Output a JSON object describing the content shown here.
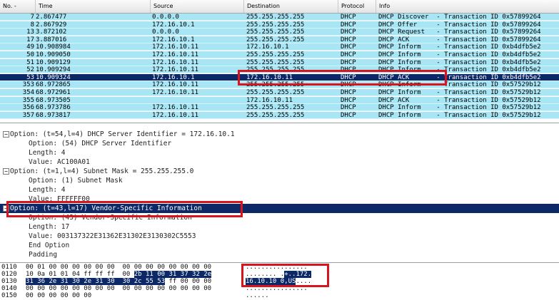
{
  "packet_list": {
    "columns": [
      "No. -",
      "Time",
      "Source",
      "Destination",
      "Protocol",
      "Info"
    ],
    "rows": [
      {
        "no": "7",
        "time": "2.867477",
        "src": "0.0.0.0",
        "dst": "255.255.255.255",
        "proto": "DHCP",
        "info": "DHCP Discover  - Transaction ID 0x57899264",
        "bg": "#a8e6f6",
        "fg": "#000000"
      },
      {
        "no": "8",
        "time": "2.867929",
        "src": "172.16.10.1",
        "dst": "255.255.255.255",
        "proto": "DHCP",
        "info": "DHCP Offer     - Transaction ID 0x57899264",
        "bg": "#a8e6f6",
        "fg": "#000000"
      },
      {
        "no": "13",
        "time": "3.872102",
        "src": "0.0.0.0",
        "dst": "255.255.255.255",
        "proto": "DHCP",
        "info": "DHCP Request   - Transaction ID 0x57899264",
        "bg": "#a8e6f6",
        "fg": "#000000"
      },
      {
        "no": "17",
        "time": "3.887016",
        "src": "172.16.10.1",
        "dst": "255.255.255.255",
        "proto": "DHCP",
        "info": "DHCP ACK       - Transaction ID 0x57899264",
        "bg": "#a8e6f6",
        "fg": "#000000"
      },
      {
        "no": "49",
        "time": "10.908984",
        "src": "172.16.10.11",
        "dst": "172.16.10.1",
        "proto": "DHCP",
        "info": "DHCP Inform    - Transaction ID 0xb4dfb5e2",
        "bg": "#a8e6f6",
        "fg": "#000000"
      },
      {
        "no": "50",
        "time": "10.909050",
        "src": "172.16.10.11",
        "dst": "255.255.255.255",
        "proto": "DHCP",
        "info": "DHCP Inform    - Transaction ID 0xb4dfb5e2",
        "bg": "#a8e6f6",
        "fg": "#000000"
      },
      {
        "no": "51",
        "time": "10.909129",
        "src": "172.16.10.11",
        "dst": "255.255.255.255",
        "proto": "DHCP",
        "info": "DHCP Inform    - Transaction ID 0xb4dfb5e2",
        "bg": "#a8e6f6",
        "fg": "#000000"
      },
      {
        "no": "52",
        "time": "10.909294",
        "src": "172.16.10.11",
        "dst": "255.255.255.255",
        "proto": "DHCP",
        "info": "DHCP Inform    - Transaction ID 0xb4dfb5e2",
        "bg": "#a8e6f6",
        "fg": "#000000"
      },
      {
        "no": "53",
        "time": "10.909324",
        "src": "172.16.10.1",
        "dst": "172.16.10.11",
        "proto": "DHCP",
        "info": "DHCP ACK       - Transaction ID 0xb4dfb5e2",
        "bg": "#0c2866",
        "fg": "#ffffff"
      },
      {
        "no": "353",
        "time": "68.972865",
        "src": "172.16.10.11",
        "dst": "255.255.255.255",
        "proto": "DHCP",
        "info": "DHCP Inform    - Transaction ID 0x57529b12",
        "bg": "#a8e6f6",
        "fg": "#000000"
      },
      {
        "no": "354",
        "time": "68.972961",
        "src": "172.16.10.11",
        "dst": "255.255.255.255",
        "proto": "DHCP",
        "info": "DHCP Inform    - Transaction ID 0x57529b12",
        "bg": "#a8e6f6",
        "fg": "#000000"
      },
      {
        "no": "355",
        "time": "68.973505",
        "src": "",
        "dst": "172.16.10.11",
        "proto": "DHCP",
        "info": "DHCP ACK       - Transaction ID 0x57529b12",
        "bg": "#a8e6f6",
        "fg": "#000000"
      },
      {
        "no": "356",
        "time": "68.973786",
        "src": "172.16.10.11",
        "dst": "255.255.255.255",
        "proto": "DHCP",
        "info": "DHCP Inform    - Transaction ID 0x57529b12",
        "bg": "#a8e6f6",
        "fg": "#000000"
      },
      {
        "no": "357",
        "time": "68.973817",
        "src": "172.16.10.11",
        "dst": "255.255.255.255",
        "proto": "DHCP",
        "info": "DHCP Inform    - Transaction ID 0x57529b12",
        "bg": "#a8e6f6",
        "fg": "#000000"
      }
    ]
  },
  "details": [
    {
      "text": "Option: (t=54,l=4) DHCP Server Identifier = 172.16.10.1",
      "level": 0,
      "expander": "minus",
      "selected": false
    },
    {
      "text": "Option: (54) DHCP Server Identifier",
      "level": 1,
      "expander": "",
      "selected": false
    },
    {
      "text": "Length: 4",
      "level": 1,
      "expander": "",
      "selected": false
    },
    {
      "text": "Value: AC100A01",
      "level": 1,
      "expander": "",
      "selected": false
    },
    {
      "text": "Option: (t=1,l=4) Subnet Mask = 255.255.255.0",
      "level": 0,
      "expander": "minus",
      "selected": false
    },
    {
      "text": "Option: (1) Subnet Mask",
      "level": 1,
      "expander": "",
      "selected": false
    },
    {
      "text": "Length: 4",
      "level": 1,
      "expander": "",
      "selected": false
    },
    {
      "text": "Value: FFFFFF00",
      "level": 1,
      "expander": "",
      "selected": false
    },
    {
      "text": "Option: (t=43,l=17) Vendor-Specific Information",
      "level": 0,
      "expander": "minus",
      "selected": true
    },
    {
      "text": "Option: (43) Vendor-Specific Information",
      "level": 1,
      "expander": "",
      "selected": false
    },
    {
      "text": "Length: 17",
      "level": 1,
      "expander": "",
      "selected": false
    },
    {
      "text": "Value: 003137322E31362E31302E3130302C5553",
      "level": 1,
      "expander": "",
      "selected": false
    },
    {
      "text": "End Option",
      "level": 1,
      "expander": "",
      "selected": false
    },
    {
      "text": "Padding",
      "level": 1,
      "expander": "",
      "selected": false
    }
  ],
  "bytes": [
    {
      "offset": "0110",
      "hex_plain": "00 01 00 00 00 00 00 00  00 00 00 00 00 00 00 00",
      "hex_sel": "",
      "hex_tail": "",
      "ascii_plain": "................",
      "ascii_sel": "",
      "ascii_tail": ""
    },
    {
      "offset": "0120",
      "hex_plain": "10 0a 01 01 04 ff ff ff  00 ",
      "hex_sel": "2b 11 00 31 37 32 2e",
      "hex_tail": "",
      "ascii_plain": "........ .",
      "ascii_sel": "+..172.",
      "ascii_tail": ""
    },
    {
      "offset": "0130",
      "hex_plain": "",
      "hex_sel": "31 36 2e 31 30 2e 31 30  30 2c 55 53",
      "hex_tail": " ff 00 00 00",
      "ascii_plain": "",
      "ascii_sel": "16.10.10 0,US",
      "ascii_tail": "...."
    },
    {
      "offset": "0140",
      "hex_plain": "00 00 00 00 00 00 00 00  00 00 00 00 00 00 00 00",
      "hex_sel": "",
      "hex_tail": "",
      "ascii_plain": "................",
      "ascii_sel": "",
      "ascii_tail": ""
    },
    {
      "offset": "0150",
      "hex_plain": "00 00 00 00 00 00",
      "hex_sel": "",
      "hex_tail": "",
      "ascii_plain": "......",
      "ascii_sel": "",
      "ascii_tail": ""
    }
  ],
  "colors": {
    "row_bg": "#a8e6f6",
    "selected_bg": "#0c2866",
    "annotation": "#d8141c"
  },
  "icons": {
    "expander": "minus-box-icon"
  }
}
